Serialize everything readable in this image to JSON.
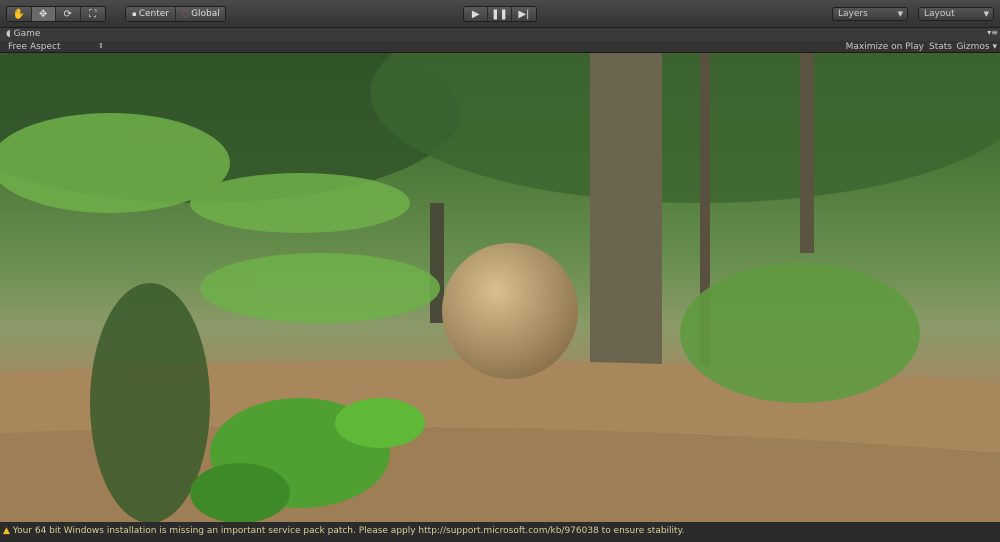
{
  "toolbar": {
    "tools": [
      {
        "icon": "hand-icon"
      },
      {
        "icon": "move-icon",
        "active": true
      },
      {
        "icon": "rotate-icon"
      },
      {
        "icon": "scale-icon"
      }
    ],
    "pivot_label": "Center",
    "space_label": "Global",
    "play": {
      "icon": "play-icon"
    },
    "pause": {
      "icon": "pause-icon"
    },
    "step": {
      "icon": "step-icon"
    },
    "layers_label": "Layers",
    "layout_label": "Layout"
  },
  "game_tab": {
    "title": "Game",
    "aspect": "Free Aspect",
    "maximize_label": "Maximize on Play",
    "stats_label": "Stats",
    "gizmos_label": "Gizmos"
  },
  "status": {
    "message": "Your 64 bit Windows installation is missing an important service pack patch. Please apply http://support.microsoft.com/kb/976038 to ensure stability.",
    "icon": "warning-icon",
    "color": "#f0c020"
  }
}
